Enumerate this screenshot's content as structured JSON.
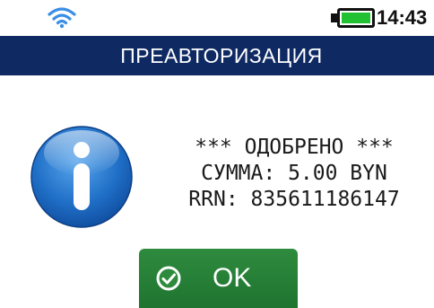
{
  "status_bar": {
    "wifi_icon": "wifi-icon",
    "battery_icon": "battery-icon",
    "battery_level": 1.0,
    "battery_color": "#22c133",
    "time": "14:43"
  },
  "header": {
    "title": "ПРЕАВТОРИЗАЦИЯ",
    "background_color": "#0f2a63"
  },
  "dialog": {
    "icon": "info-icon",
    "lines": [
      "*** ОДОБРЕНО ***",
      "СУММА: 5.00 BYN",
      "RRN: 835611186147"
    ]
  },
  "ok_button": {
    "icon": "check-circle-icon",
    "label": "OK",
    "color": "#1f7430"
  }
}
